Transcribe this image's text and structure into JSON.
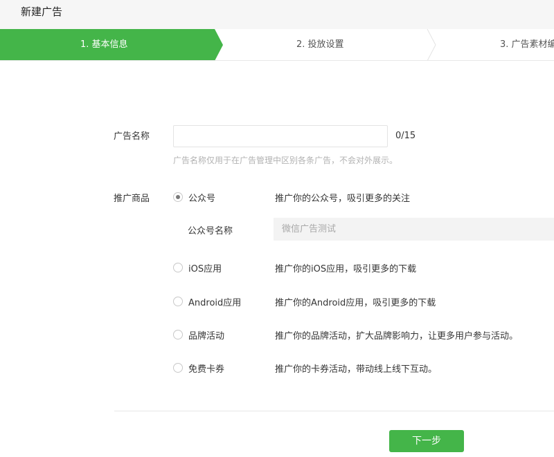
{
  "header": {
    "title": "新建广告"
  },
  "steps": [
    {
      "label": "1. 基本信息",
      "active": true
    },
    {
      "label": "2. 投放设置",
      "active": false
    },
    {
      "label": "3. 广告素材编",
      "active": false
    }
  ],
  "form": {
    "ad_name": {
      "label": "广告名称",
      "value": "",
      "counter": "0/15",
      "hint": "广告名称仅用于在广告管理中区别各条广告，不会对外展示。"
    },
    "promo": {
      "label": "推广商品",
      "options": [
        {
          "label": "公众号",
          "desc": "推广你的公众号，吸引更多的关注",
          "checked": true
        },
        {
          "label": "iOS应用",
          "desc": "推广你的iOS应用，吸引更多的下载",
          "checked": false
        },
        {
          "label": "Android应用",
          "desc": "推广你的Android应用，吸引更多的下载",
          "checked": false
        },
        {
          "label": "品牌活动",
          "desc": "推广你的品牌活动，扩大品牌影响力，让更多用户参与活动。",
          "checked": false
        },
        {
          "label": "免费卡券",
          "desc": "推广你的卡券活动，带动线上线下互动。",
          "checked": false
        }
      ],
      "account_name": {
        "label": "公众号名称",
        "placeholder": "微信广告测试"
      }
    }
  },
  "footer": {
    "next_label": "下一步"
  },
  "colors": {
    "accent": "#44b549",
    "step_active": "#44b549"
  }
}
